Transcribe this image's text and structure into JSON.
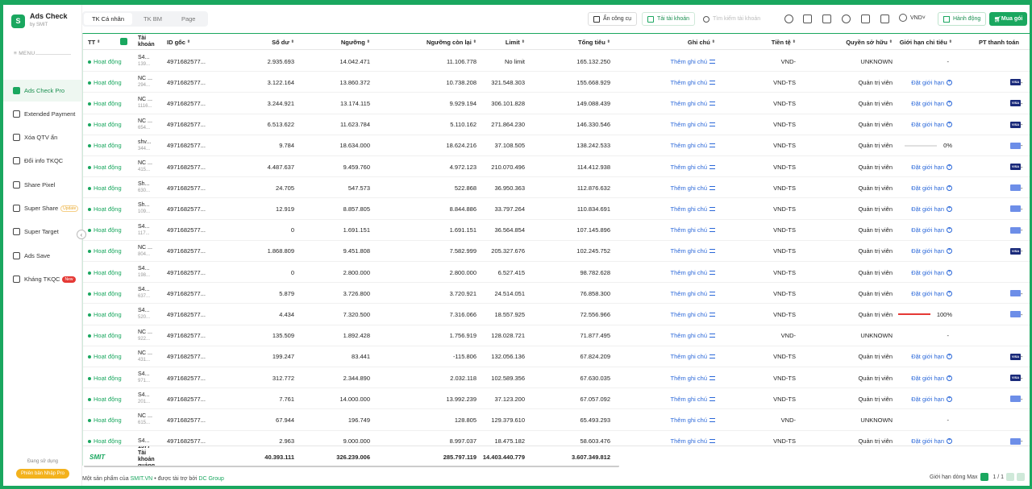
{
  "brand": {
    "name": "Ads Check",
    "sub": "by SMIT",
    "logo": "S"
  },
  "menu_label": "≡ MENU",
  "nav": [
    {
      "label": "Ads Check Pro",
      "icon": "chart-icon",
      "active": true
    },
    {
      "label": "Extended Payment",
      "icon": "card-icon"
    },
    {
      "label": "Xóa QTV ẩn",
      "icon": "user-remove-icon"
    },
    {
      "label": "Đổi info TKQC",
      "icon": "edit-icon"
    },
    {
      "label": "Share Pixel",
      "icon": "pixel-icon"
    },
    {
      "label": "Super Share",
      "icon": "share-icon",
      "badge": "Update"
    },
    {
      "label": "Super Target",
      "icon": "target-icon"
    },
    {
      "label": "Ads Save",
      "icon": "save-icon"
    },
    {
      "label": "Kháng TKQC",
      "icon": "shield-icon",
      "badge": "New"
    }
  ],
  "sidebar_footer": {
    "using": "Đang sử dụng",
    "plan": "Phiên bản Nhập Pro"
  },
  "tabs": [
    "TK Cá nhân",
    "TK BM",
    "Page"
  ],
  "toolbar": {
    "hide_tool": "Ẩn công cụ",
    "reload_accounts": "Tải tài khoản",
    "search_placeholder": "Tìm kiếm tài khoản",
    "currency": "VND",
    "actions": "Hành động",
    "buy": "Mua gói"
  },
  "columns": {
    "tt": "TT",
    "account": "Tài khoản",
    "root_id": "ID gốc",
    "balance": "Số dư",
    "threshold": "Ngưỡng",
    "remaining": "Ngưỡng còn lại",
    "limit": "Limit",
    "total_spend": "Tổng tiêu",
    "note": "Ghi chú",
    "currency": "Tiền tệ",
    "ownership": "Quyền sở hữu",
    "spend_limit": "Giới hạn chi tiêu",
    "payment": "PT thanh toán"
  },
  "rows": [
    {
      "status": "Hoạt động",
      "acc": "S4...",
      "accsub": "139...",
      "id": "4971682577...",
      "bal": "2.935.693",
      "thr": "14.042.471",
      "rem": "11.106.778",
      "lim": "No limit",
      "tot": "165.132.250",
      "note": "Thêm ghi chú",
      "cur": "VND-",
      "own": "UNKNOWN",
      "sl": "-",
      "slt": "dash",
      "pay": "none"
    },
    {
      "status": "Hoạt động",
      "acc": "NC ...",
      "accsub": "294...",
      "id": "4971682577...",
      "bal": "3.122.164",
      "thr": "13.860.372",
      "rem": "10.738.208",
      "lim": "321.548.303",
      "tot": "155.668.929",
      "note": "Thêm ghi chú",
      "cur": "VND-TS",
      "own": "Quản trị viên",
      "sl": "Đặt giới hạn",
      "slt": "link",
      "pay": "visa"
    },
    {
      "status": "Hoạt động",
      "acc": "NC ...",
      "accsub": "1116...",
      "id": "4971682577...",
      "bal": "3.244.921",
      "thr": "13.174.115",
      "rem": "9.929.194",
      "lim": "306.101.828",
      "tot": "149.088.439",
      "note": "Thêm ghi chú",
      "cur": "VND-TS",
      "own": "Quản trị viên",
      "sl": "Đặt giới hạn",
      "slt": "link",
      "pay": "visa"
    },
    {
      "status": "Hoạt động",
      "acc": "NC ...",
      "accsub": "654...",
      "id": "4971682577...",
      "bal": "6.513.622",
      "thr": "11.623.784",
      "rem": "5.110.162",
      "lim": "271.864.230",
      "tot": "146.330.546",
      "note": "Thêm ghi chú",
      "cur": "VND-TS",
      "own": "Quản trị viên",
      "sl": "Đặt giới hạn",
      "slt": "link",
      "pay": "visa"
    },
    {
      "status": "Hoạt động",
      "acc": "shv...",
      "accsub": "344...",
      "id": "4971682577...",
      "bal": "9.784",
      "thr": "18.634.000",
      "rem": "18.624.216",
      "lim": "37.108.505",
      "tot": "138.242.533",
      "note": "Thêm ghi chú",
      "cur": "VND-TS",
      "own": "Quản trị viên",
      "sl": "0%",
      "slt": "bar",
      "pay": "other"
    },
    {
      "status": "Hoạt động",
      "acc": "NC ...",
      "accsub": "415...",
      "id": "4971682577...",
      "bal": "4.487.637",
      "thr": "9.459.760",
      "rem": "4.972.123",
      "lim": "210.070.496",
      "tot": "114.412.938",
      "note": "Thêm ghi chú",
      "cur": "VND-TS",
      "own": "Quản trị viên",
      "sl": "Đặt giới hạn",
      "slt": "link",
      "pay": "visa"
    },
    {
      "status": "Hoạt động",
      "acc": "Sh...",
      "accsub": "630...",
      "id": "4971682577...",
      "bal": "24.705",
      "thr": "547.573",
      "rem": "522.868",
      "lim": "36.950.363",
      "tot": "112.876.632",
      "note": "Thêm ghi chú",
      "cur": "VND-TS",
      "own": "Quản trị viên",
      "sl": "Đặt giới hạn",
      "slt": "link",
      "pay": "other"
    },
    {
      "status": "Hoạt động",
      "acc": "Sh...",
      "accsub": "109...",
      "id": "4971682577...",
      "bal": "12.919",
      "thr": "8.857.805",
      "rem": "8.844.886",
      "lim": "33.797.264",
      "tot": "110.834.691",
      "note": "Thêm ghi chú",
      "cur": "VND-TS",
      "own": "Quản trị viên",
      "sl": "Đặt giới hạn",
      "slt": "link",
      "pay": "other"
    },
    {
      "status": "Hoạt động",
      "acc": "S4...",
      "accsub": "117...",
      "id": "4971682577...",
      "bal": "0",
      "thr": "1.691.151",
      "rem": "1.691.151",
      "lim": "36.564.854",
      "tot": "107.145.896",
      "note": "Thêm ghi chú",
      "cur": "VND-TS",
      "own": "Quản trị viên",
      "sl": "Đặt giới hạn",
      "slt": "link",
      "pay": "other"
    },
    {
      "status": "Hoạt động",
      "acc": "NC ...",
      "accsub": "804...",
      "id": "4971682577...",
      "bal": "1.868.809",
      "thr": "9.451.808",
      "rem": "7.582.999",
      "lim": "205.327.676",
      "tot": "102.245.752",
      "note": "Thêm ghi chú",
      "cur": "VND-TS",
      "own": "Quản trị viên",
      "sl": "Đặt giới hạn",
      "slt": "link",
      "pay": "visa"
    },
    {
      "status": "Hoạt động",
      "acc": "S4...",
      "accsub": "198...",
      "id": "4971682577...",
      "bal": "0",
      "thr": "2.800.000",
      "rem": "2.800.000",
      "lim": "6.527.415",
      "tot": "98.782.628",
      "note": "Thêm ghi chú",
      "cur": "VND-TS",
      "own": "Quản trị viên",
      "sl": "Đặt giới hạn",
      "slt": "link",
      "pay": "none"
    },
    {
      "status": "Hoạt động",
      "acc": "S4...",
      "accsub": "637...",
      "id": "4971682577...",
      "bal": "5.879",
      "thr": "3.726.800",
      "rem": "3.720.921",
      "lim": "24.514.051",
      "tot": "76.858.300",
      "note": "Thêm ghi chú",
      "cur": "VND-TS",
      "own": "Quản trị viên",
      "sl": "Đặt giới hạn",
      "slt": "link",
      "pay": "other"
    },
    {
      "status": "Hoạt động",
      "acc": "S4...",
      "accsub": "520...",
      "id": "4971682577...",
      "bal": "4.434",
      "thr": "7.320.500",
      "rem": "7.316.066",
      "lim": "18.557.925",
      "tot": "72.556.966",
      "note": "Thêm ghi chú",
      "cur": "VND-TS",
      "own": "Quản trị viên",
      "sl": "100%",
      "slt": "bar",
      "pay": "other"
    },
    {
      "status": "Hoạt động",
      "acc": "NC ...",
      "accsub": "922...",
      "id": "4971682577...",
      "bal": "135.509",
      "thr": "1.892.428",
      "rem": "1.756.919",
      "lim": "128.028.721",
      "tot": "71.877.495",
      "note": "Thêm ghi chú",
      "cur": "VND-",
      "own": "UNKNOWN",
      "sl": "-",
      "slt": "dash",
      "pay": "none"
    },
    {
      "status": "Hoạt động",
      "acc": "NC ...",
      "accsub": "431...",
      "id": "4971682577...",
      "bal": "199.247",
      "thr": "83.441",
      "rem": "-115.806",
      "lim": "132.056.136",
      "tot": "67.824.209",
      "note": "Thêm ghi chú",
      "cur": "VND-TS",
      "own": "Quản trị viên",
      "sl": "Đặt giới hạn",
      "slt": "link",
      "pay": "visa"
    },
    {
      "status": "Hoạt động",
      "acc": "S4...",
      "accsub": "971...",
      "id": "4971682577...",
      "bal": "312.772",
      "thr": "2.344.890",
      "rem": "2.032.118",
      "lim": "102.589.356",
      "tot": "67.630.035",
      "note": "Thêm ghi chú",
      "cur": "VND-TS",
      "own": "Quản trị viên",
      "sl": "Đặt giới hạn",
      "slt": "link",
      "pay": "visa"
    },
    {
      "status": "Hoạt động",
      "acc": "S4...",
      "accsub": "201...",
      "id": "4971682577...",
      "bal": "7.761",
      "thr": "14.000.000",
      "rem": "13.992.239",
      "lim": "37.123.200",
      "tot": "67.057.092",
      "note": "Thêm ghi chú",
      "cur": "VND-TS",
      "own": "Quản trị viên",
      "sl": "Đặt giới hạn",
      "slt": "link",
      "pay": "other"
    },
    {
      "status": "Hoạt động",
      "acc": "NC ...",
      "accsub": "615...",
      "id": "4971682577...",
      "bal": "67.944",
      "thr": "196.749",
      "rem": "128.805",
      "lim": "129.379.610",
      "tot": "65.493.293",
      "note": "Thêm ghi chú",
      "cur": "VND-",
      "own": "UNKNOWN",
      "sl": "-",
      "slt": "dash",
      "pay": "none"
    },
    {
      "status": "Hoạt động",
      "acc": "S4...",
      "accsub": "",
      "id": "4971682577...",
      "bal": "2.963",
      "thr": "9.000.000",
      "rem": "8.997.037",
      "lim": "18.475.182",
      "tot": "58.603.476",
      "note": "Thêm ghi chú",
      "cur": "VND-TS",
      "own": "Quản trị viên",
      "sl": "Đặt giới hạn",
      "slt": "link",
      "pay": "other"
    }
  ],
  "summary": {
    "logo": "SMIT",
    "count": "1577",
    "count_label": "Tài khoản quảng",
    "bal": "40.393.111",
    "thr": "326.239.006",
    "rem": "285.797.119",
    "lim": "14.403.440.779",
    "tot": "3.607.349.812"
  },
  "footer": {
    "product_of": "Một sản phẩm của",
    "smit": "SMIT.VN",
    "sponsor": "• được tài trợ bởi",
    "dc": "DC Group",
    "limit_label": "Giới hạn dòng",
    "limit_value": "Max",
    "page": "1 / 1"
  },
  "colors": {
    "accent": "#1aa75f",
    "link": "#2b68d9",
    "visa": "#1a2a7a",
    "danger": "#e53935"
  }
}
